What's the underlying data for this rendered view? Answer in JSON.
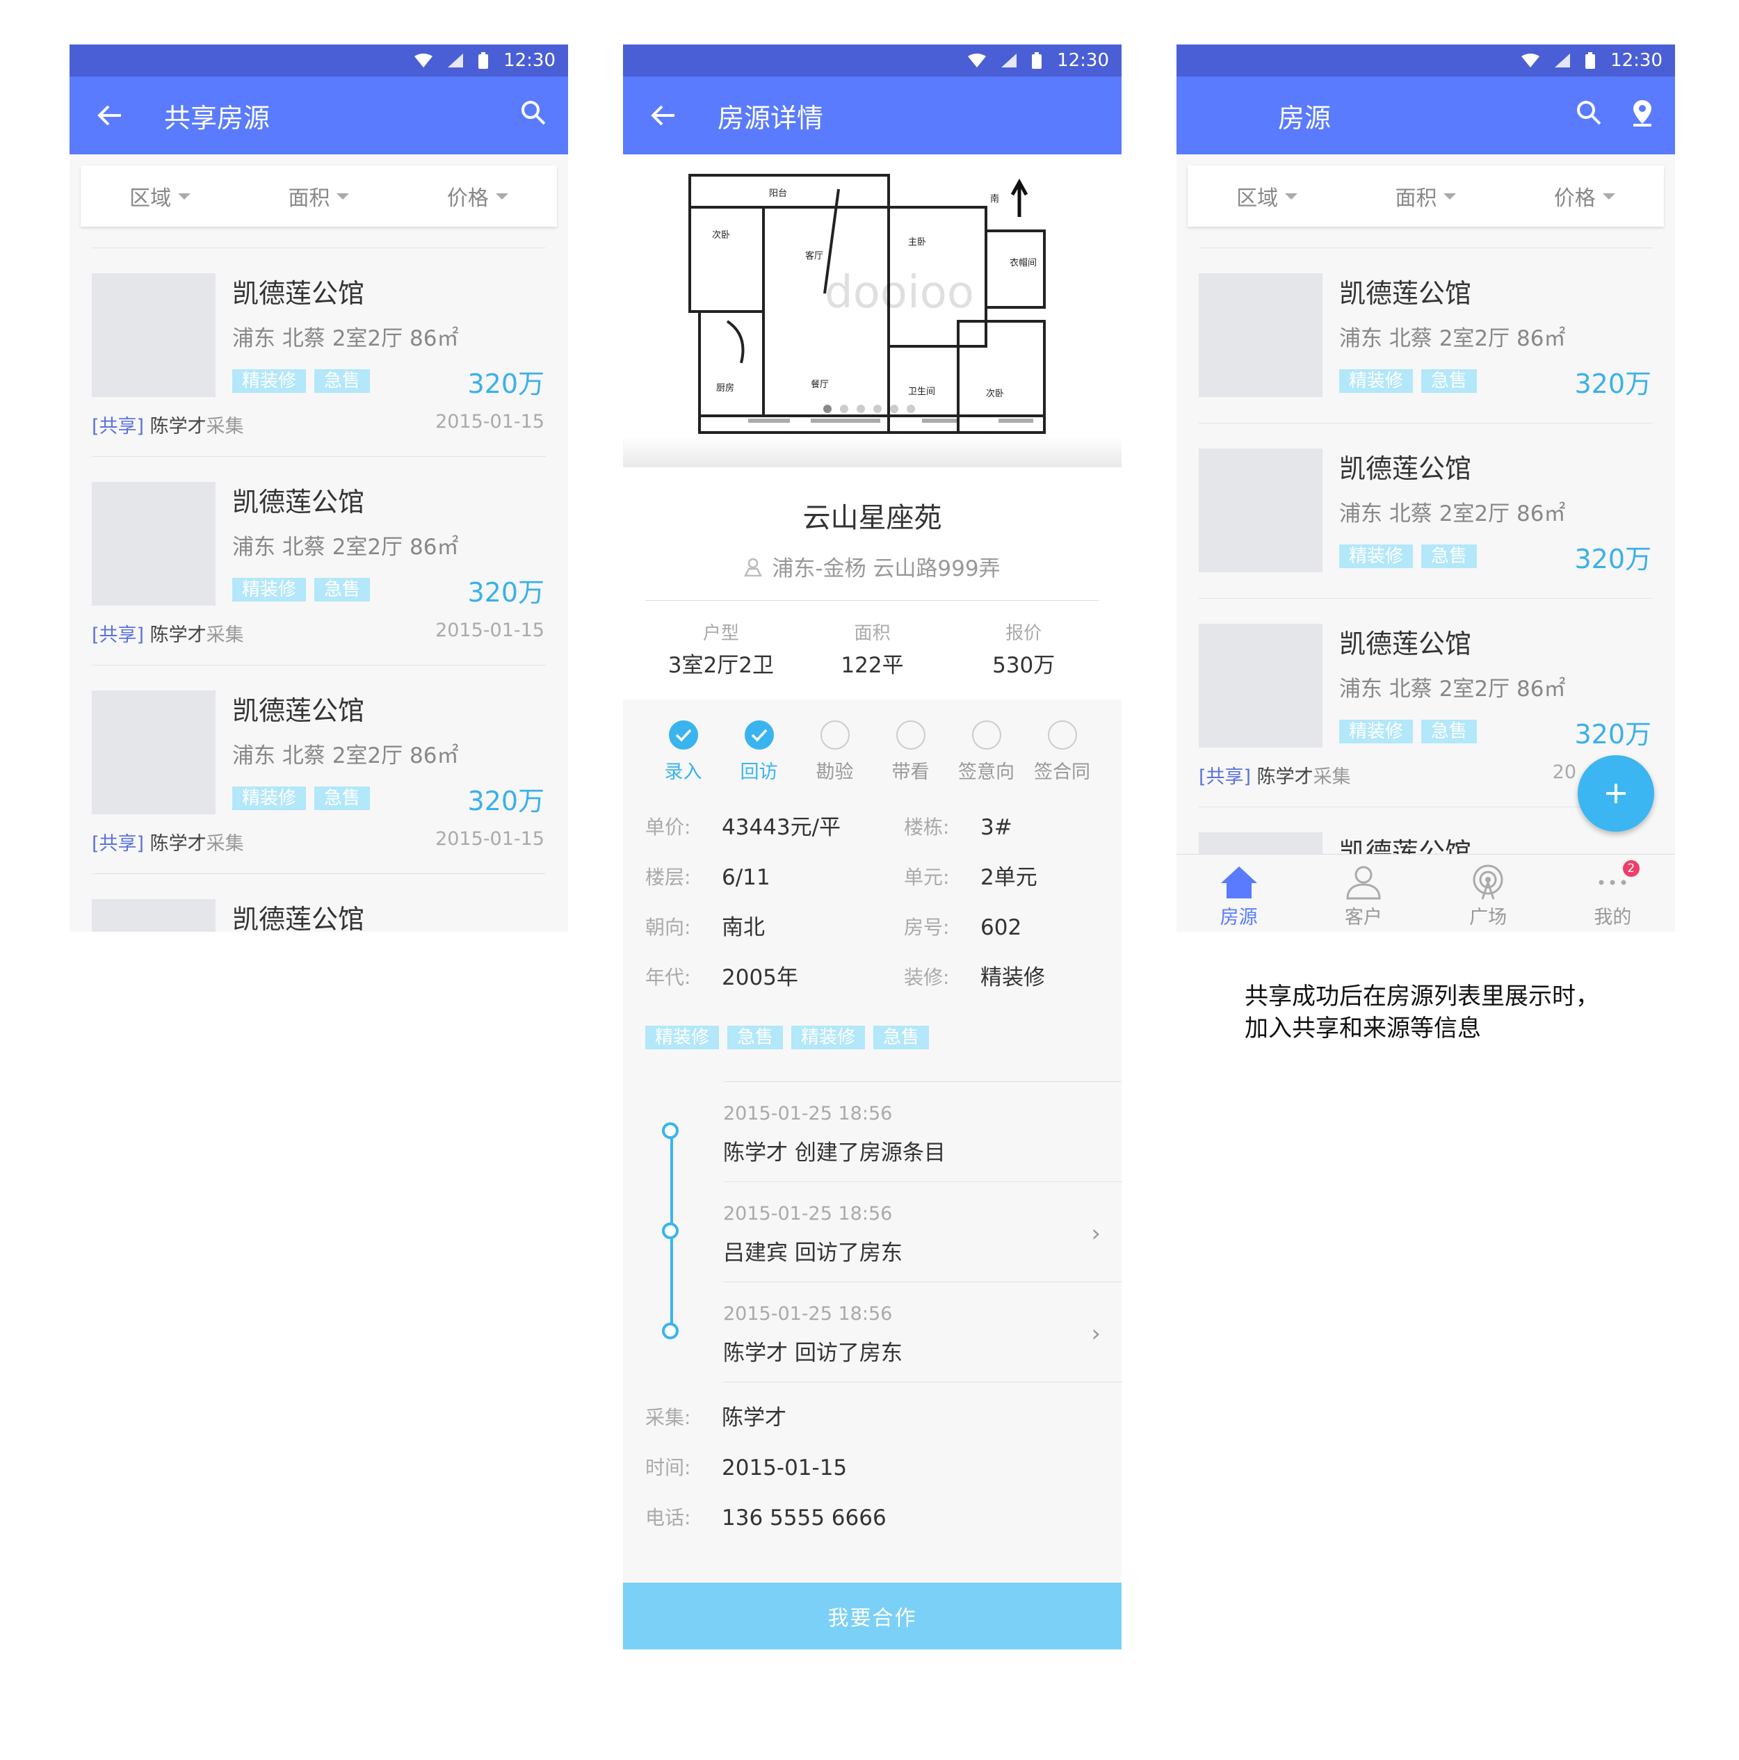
{
  "status": {
    "time": "12:30"
  },
  "list_screen": {
    "title": "共享房源",
    "filters": [
      "区域",
      "面积",
      "价格"
    ],
    "items": [
      {
        "name": "凯德莲公馆",
        "meta": "浦东 北蔡  2室2厅  86㎡",
        "tags": [
          "精装修",
          "急售"
        ],
        "price": "320万",
        "share": "[共享]",
        "owner": "陈学才",
        "src": "采集",
        "date": "2015-01-15"
      },
      {
        "name": "凯德莲公馆",
        "meta": "浦东 北蔡  2室2厅  86㎡",
        "tags": [
          "精装修",
          "急售"
        ],
        "price": "320万",
        "share": "[共享]",
        "owner": "陈学才",
        "src": "采集",
        "date": "2015-01-15"
      },
      {
        "name": "凯德莲公馆",
        "meta": "浦东 北蔡  2室2厅  86㎡",
        "tags": [
          "精装修",
          "急售"
        ],
        "price": "320万",
        "share": "[共享]",
        "owner": "陈学才",
        "src": "采集",
        "date": "2015-01-15"
      },
      {
        "name": "凯德莲公馆"
      }
    ]
  },
  "detail_screen": {
    "title": "房源详情",
    "floorplan_rooms": [
      "阳台",
      "次卧",
      "客厅",
      "主卧",
      "衣帽间",
      "厨房",
      "餐厅",
      "卫生间",
      "次卧",
      "南"
    ],
    "watermark": "dooioo",
    "name": "云山星座苑",
    "address": "浦东-金杨  云山路999弄",
    "summary": [
      {
        "label": "户型",
        "value": "3室2厅2卫"
      },
      {
        "label": "面积",
        "value": "122平"
      },
      {
        "label": "报价",
        "value": "530万"
      }
    ],
    "steps": [
      {
        "label": "录入",
        "done": true
      },
      {
        "label": "回访",
        "done": true
      },
      {
        "label": "勘验",
        "done": false
      },
      {
        "label": "带看",
        "done": false
      },
      {
        "label": "签意向",
        "done": false
      },
      {
        "label": "签合同",
        "done": false
      }
    ],
    "props": [
      {
        "k": "单价:",
        "v": "43443元/平"
      },
      {
        "k": "楼栋:",
        "v": "3#"
      },
      {
        "k": "楼层:",
        "v": "6/11"
      },
      {
        "k": "单元:",
        "v": "2单元"
      },
      {
        "k": "朝向:",
        "v": "南北"
      },
      {
        "k": "房号:",
        "v": "602"
      },
      {
        "k": "年代:",
        "v": "2005年"
      },
      {
        "k": "装修:",
        "v": "精装修"
      }
    ],
    "tags": [
      "精装修",
      "急售",
      "精装修",
      "急售"
    ],
    "timeline": [
      {
        "time": "2015-01-25  18:56",
        "text": "陈学才 创建了房源条目"
      },
      {
        "time": "2015-01-25  18:56",
        "text": "吕建宾 回访了房东"
      },
      {
        "time": "2015-01-25  18:56",
        "text": "陈学才 回访了房东"
      }
    ],
    "contact": [
      {
        "k": "采集:",
        "v": "陈学才"
      },
      {
        "k": "时间:",
        "v": "2015-01-15"
      },
      {
        "k": "电话:",
        "v": "136 5555 6666"
      }
    ],
    "cta": "我要合作"
  },
  "main_screen": {
    "title": "房源",
    "filters": [
      "区域",
      "面积",
      "价格"
    ],
    "items": [
      {
        "name": "凯德莲公馆",
        "meta": "浦东 北蔡  2室2厅  86㎡",
        "tags": [
          "精装修",
          "急售"
        ],
        "price": "320万"
      },
      {
        "name": "凯德莲公馆",
        "meta": "浦东 北蔡  2室2厅  86㎡",
        "tags": [
          "精装修",
          "急售"
        ],
        "price": "320万"
      },
      {
        "name": "凯德莲公馆",
        "meta": "浦东 北蔡  2室2厅  86㎡",
        "tags": [
          "精装修",
          "急售"
        ],
        "price": "320万",
        "share": "[共享]",
        "owner": "陈学才",
        "src": "采集",
        "date": "20"
      },
      {
        "name": "凯德莲公馆"
      }
    ],
    "tabs": [
      {
        "label": "房源",
        "icon": "home-icon",
        "active": true
      },
      {
        "label": "客户",
        "icon": "person-icon"
      },
      {
        "label": "广场",
        "icon": "broadcast-icon"
      },
      {
        "label": "我的",
        "icon": "more-icon",
        "badge": "2"
      }
    ]
  },
  "note": {
    "line1": "共享成功后在房源列表里展示时，",
    "line2": "加入共享和来源等信息"
  },
  "colors": {
    "appbar": "#5a7bfd",
    "statusbar": "#4a5fd5",
    "accent": "#3ab4ef",
    "tag": "#b3e7fa",
    "badge": "#ef3d6a"
  }
}
